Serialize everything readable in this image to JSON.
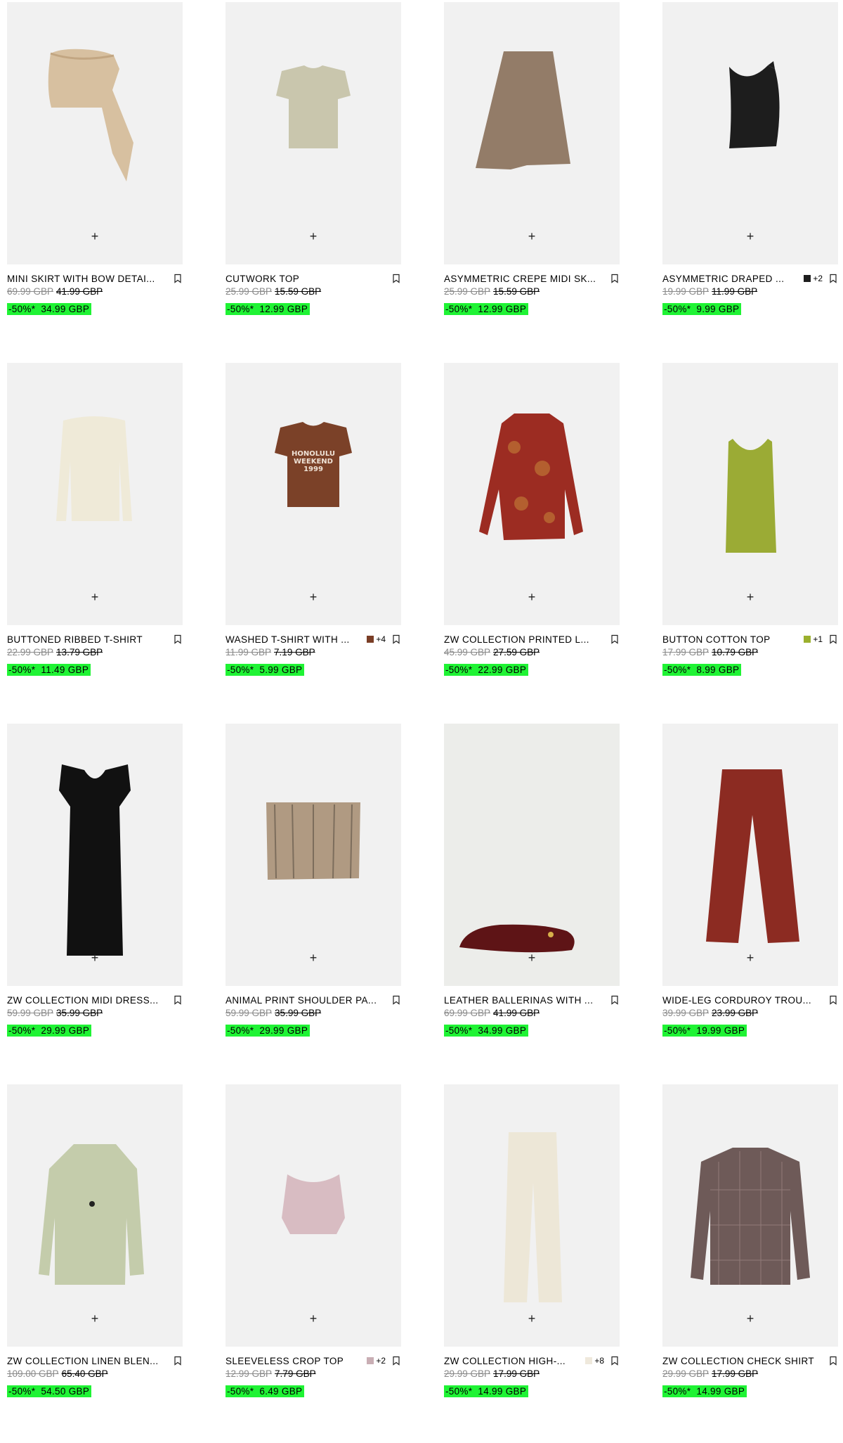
{
  "products": [
    {
      "name": "MINI SKIRT WITH BOW DETAI...",
      "old": "69.99 GBP",
      "mid": "41.99 GBP",
      "badge": "-50%*",
      "sale": "34.99 GBP",
      "swatch": "",
      "swatch_color": "",
      "more": ""
    },
    {
      "name": "CUTWORK TOP",
      "old": "25.99 GBP",
      "mid": "15.59 GBP",
      "badge": "-50%*",
      "sale": "12.99 GBP",
      "swatch": "",
      "swatch_color": "",
      "more": ""
    },
    {
      "name": "ASYMMETRIC CREPE MIDI SK...",
      "old": "25.99 GBP",
      "mid": "15.59 GBP",
      "badge": "-50%*",
      "sale": "12.99 GBP",
      "swatch": "",
      "swatch_color": "",
      "more": ""
    },
    {
      "name": "ASYMMETRIC DRAPED ...",
      "old": "19.99 GBP",
      "mid": "11.99 GBP",
      "badge": "-50%*",
      "sale": "9.99 GBP",
      "swatch": "yes",
      "swatch_color": "#1e1e1e",
      "more": "+2"
    },
    {
      "name": "BUTTONED RIBBED T-SHIRT",
      "old": "22.99 GBP",
      "mid": "13.79 GBP",
      "badge": "-50%*",
      "sale": "11.49 GBP",
      "swatch": "",
      "swatch_color": "",
      "more": ""
    },
    {
      "name": "WASHED T-SHIRT WITH ...",
      "old": "11.99 GBP",
      "mid": "7.19 GBP",
      "badge": "-50%*",
      "sale": "5.99 GBP",
      "swatch": "yes",
      "swatch_color": "#7a3e26",
      "more": "+4"
    },
    {
      "name": "ZW COLLECTION PRINTED L...",
      "old": "45.99 GBP",
      "mid": "27.59 GBP",
      "badge": "-50%*",
      "sale": "22.99 GBP",
      "swatch": "",
      "swatch_color": "",
      "more": ""
    },
    {
      "name": "BUTTON COTTON TOP",
      "old": "17.99 GBP",
      "mid": "10.79 GBP",
      "badge": "-50%*",
      "sale": "8.99 GBP",
      "swatch": "yes",
      "swatch_color": "#9bb02e",
      "more": "+1"
    },
    {
      "name": "ZW COLLECTION MIDI DRESS...",
      "old": "59.99 GBP",
      "mid": "35.99 GBP",
      "badge": "-50%*",
      "sale": "29.99 GBP",
      "swatch": "",
      "swatch_color": "",
      "more": ""
    },
    {
      "name": "ANIMAL PRINT SHOULDER PA...",
      "old": "59.99 GBP",
      "mid": "35.99 GBP",
      "badge": "-50%*",
      "sale": "29.99 GBP",
      "swatch": "",
      "swatch_color": "",
      "more": ""
    },
    {
      "name": "LEATHER BALLERINAS WITH ...",
      "old": "69.99 GBP",
      "mid": "41.99 GBP",
      "badge": "-50%*",
      "sale": "34.99 GBP",
      "swatch": "",
      "swatch_color": "",
      "more": ""
    },
    {
      "name": "WIDE-LEG CORDUROY TROU...",
      "old": "39.99 GBP",
      "mid": "23.99 GBP",
      "badge": "-50%*",
      "sale": "19.99 GBP",
      "swatch": "",
      "swatch_color": "",
      "more": ""
    },
    {
      "name": "ZW COLLECTION LINEN BLEN...",
      "old": "109.00 GBP",
      "mid": "65.40 GBP",
      "badge": "-50%*",
      "sale": "54.50 GBP",
      "swatch": "",
      "swatch_color": "",
      "more": ""
    },
    {
      "name": "SLEEVELESS CROP TOP",
      "old": "12.99 GBP",
      "mid": "7.79 GBP",
      "badge": "-50%*",
      "sale": "6.49 GBP",
      "swatch": "yes",
      "swatch_color": "#c9aeb4",
      "more": "+2"
    },
    {
      "name": "ZW COLLECTION HIGH-...",
      "old": "29.99 GBP",
      "mid": "17.99 GBP",
      "badge": "-50%*",
      "sale": "14.99 GBP",
      "swatch": "yes",
      "swatch_color": "#efe9dc",
      "more": "+8"
    },
    {
      "name": "ZW COLLECTION CHECK SHIRT",
      "old": "29.99 GBP",
      "mid": "17.99 GBP",
      "badge": "-50%*",
      "sale": "14.99 GBP",
      "swatch": "",
      "swatch_color": "",
      "more": ""
    }
  ],
  "add_icon": "+",
  "image_text": {
    "tshirt_print_1": "HONOLULU",
    "tshirt_print_2": "WEEKEND",
    "tshirt_print_3": "1999"
  },
  "colors": {
    "sale_highlight": "#1ff334",
    "old_price": "#8a8a8a",
    "image_bg": "#f1f1f1"
  }
}
